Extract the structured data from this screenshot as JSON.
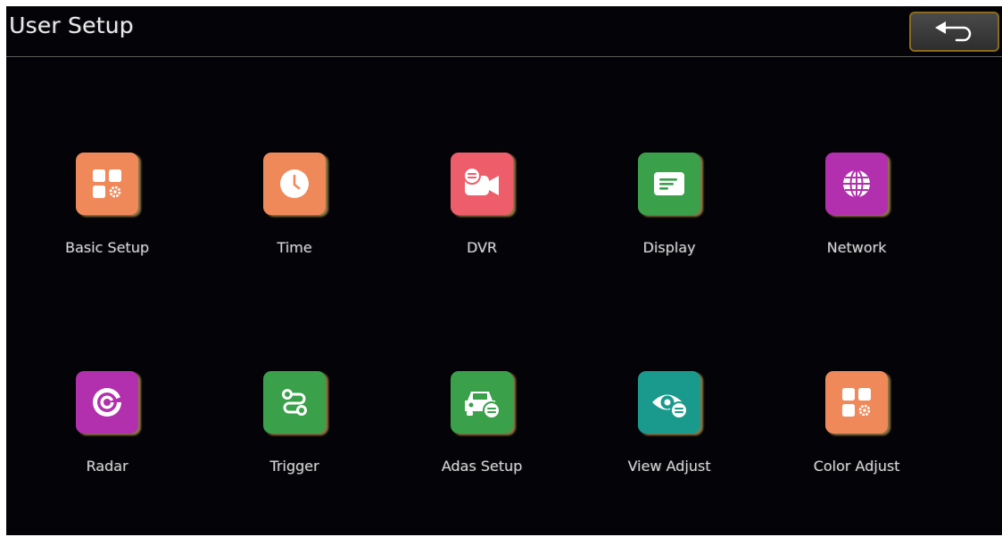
{
  "header": {
    "title": "User Setup",
    "back_icon": "back-arrow-icon"
  },
  "colors": {
    "background": "#040307",
    "orange": "#f0895a",
    "red": "#ee5d6a",
    "green": "#3aa04a",
    "purple": "#b22fae",
    "teal": "#1a9a8c"
  },
  "menu": {
    "items": [
      {
        "label": "Basic Setup",
        "icon": "grid-gear-icon",
        "color": "#f0895a"
      },
      {
        "label": "Time",
        "icon": "clock-icon",
        "color": "#f0895a"
      },
      {
        "label": "DVR",
        "icon": "video-camera-icon",
        "color": "#ee5d6a"
      },
      {
        "label": "Display",
        "icon": "display-icon",
        "color": "#3aa04a"
      },
      {
        "label": "Network",
        "icon": "globe-icon",
        "color": "#b22fae"
      },
      {
        "label": "Radar",
        "icon": "radar-icon",
        "color": "#b22fae"
      },
      {
        "label": "Trigger",
        "icon": "trigger-path-icon",
        "color": "#3aa04a"
      },
      {
        "label": "Adas Setup",
        "icon": "car-settings-icon",
        "color": "#3aa04a"
      },
      {
        "label": "View Adjust",
        "icon": "eye-adjust-icon",
        "color": "#1a9a8c"
      },
      {
        "label": "Color Adjust",
        "icon": "grid-gear-icon",
        "color": "#f0895a"
      }
    ]
  }
}
